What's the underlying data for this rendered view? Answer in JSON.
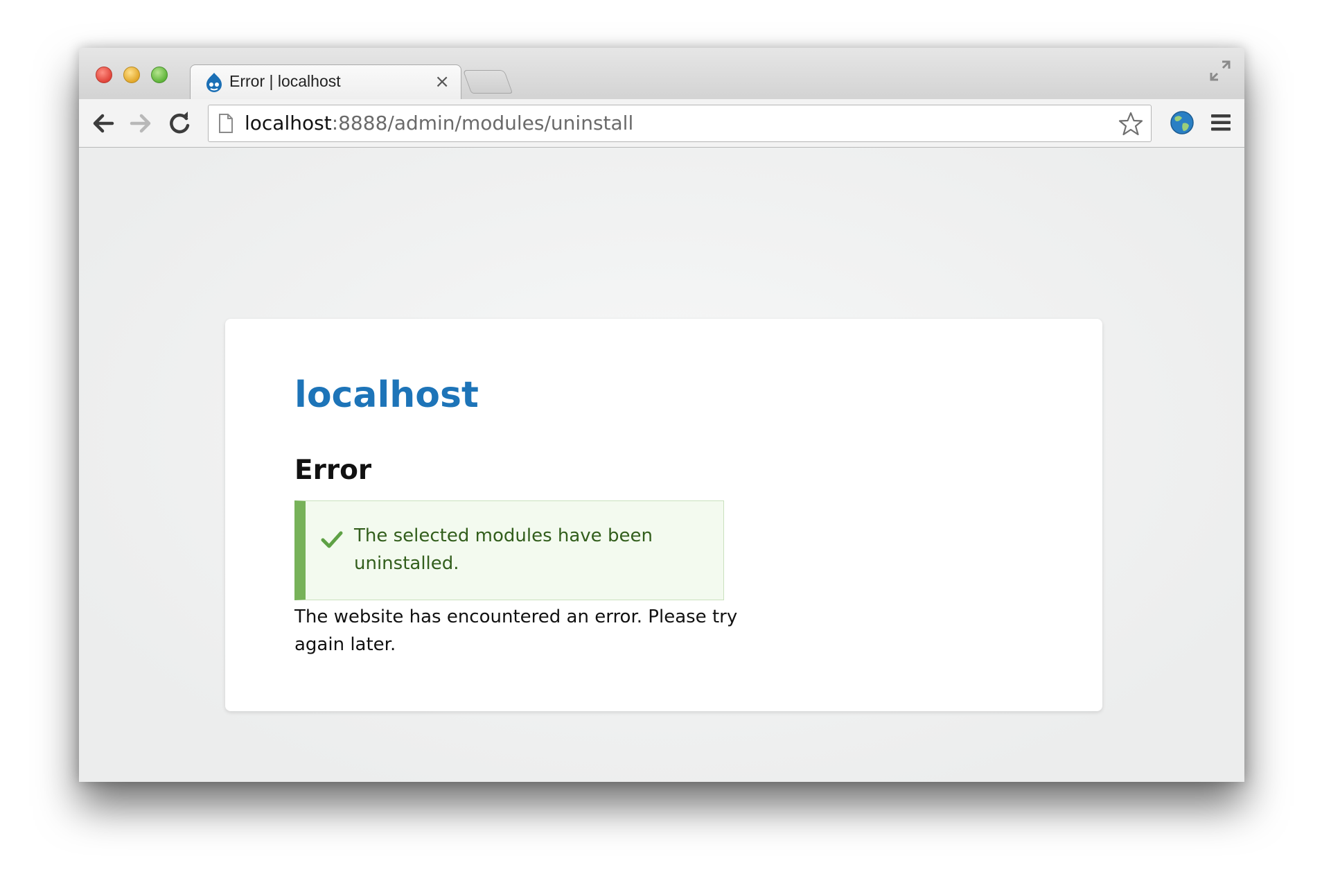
{
  "browser": {
    "tab": {
      "title": "Error | localhost",
      "close_glyph": "×",
      "favicon": "drupal-drop-icon"
    },
    "address_bar": {
      "host": "localhost",
      "rest": ":8888/admin/modules/uninstall"
    },
    "icons": {
      "back": "back-arrow-icon",
      "forward": "forward-arrow-icon",
      "reload": "reload-icon",
      "bookmark": "star-icon",
      "extension": "globe-icon",
      "menu": "hamburger-menu-icon",
      "fullscreen": "fullscreen-icon"
    }
  },
  "page": {
    "site_name": "localhost",
    "title": "Error",
    "status_message": "The selected modules have been uninstalled.",
    "error_message": "The website has encountered an error. Please try again later."
  },
  "colors": {
    "site_name": "#1d74b8",
    "status_bar": "#77b259",
    "status_bg": "#f3faef",
    "status_text": "#325e1c"
  }
}
